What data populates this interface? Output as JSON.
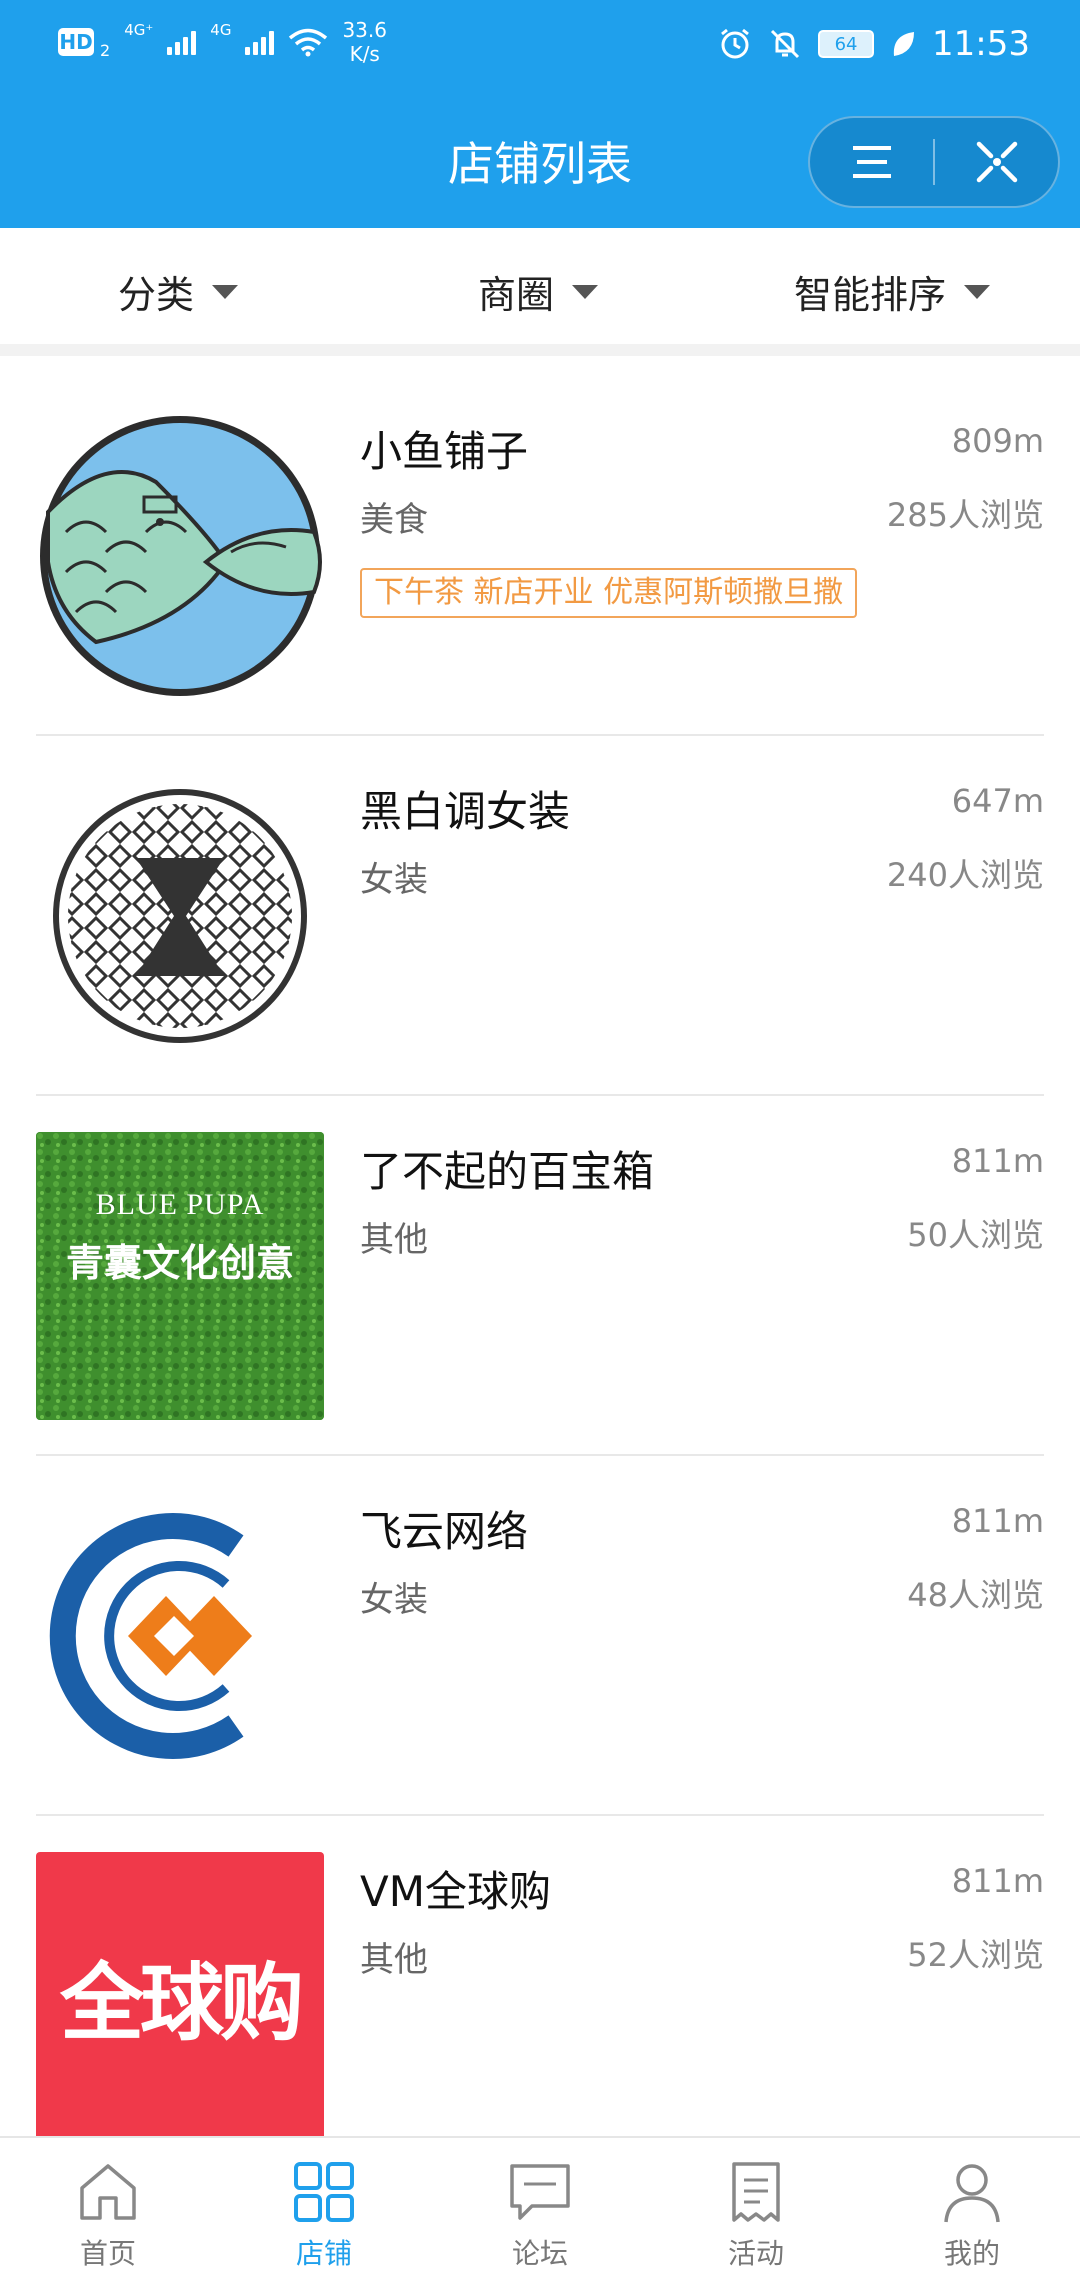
{
  "status_bar": {
    "hd": "HD",
    "hd_sub": "2",
    "net1": "4G⁺",
    "net2": "4G",
    "speed_value": "33.6",
    "speed_unit": "K/s",
    "battery": "64",
    "time": "11:53"
  },
  "header": {
    "title": "店铺列表"
  },
  "filters": [
    {
      "label": "分类"
    },
    {
      "label": "商圈"
    },
    {
      "label": "智能排序"
    }
  ],
  "shops": [
    {
      "name": "小鱼铺子",
      "category": "美食",
      "distance": "809m",
      "views": "285人浏览",
      "tag": "下午茶 新店开业 优惠阿斯顿撒旦撒"
    },
    {
      "name": "黑白调女装",
      "category": "女装",
      "distance": "647m",
      "views": "240人浏览"
    },
    {
      "name": "了不起的百宝箱",
      "category": "其他",
      "distance": "811m",
      "views": "50人浏览",
      "logo_text_en": "BLUE PUPA",
      "logo_text_cn": "青囊文化创意"
    },
    {
      "name": "飞云网络",
      "category": "女装",
      "distance": "811m",
      "views": "48人浏览"
    },
    {
      "name": "VM全球购",
      "category": "其他",
      "distance": "811m",
      "views": "52人浏览",
      "logo_text": "全球购"
    }
  ],
  "tabs": [
    {
      "label": "首页",
      "icon": "home-icon"
    },
    {
      "label": "店铺",
      "icon": "grid-icon",
      "active": true
    },
    {
      "label": "论坛",
      "icon": "chat-icon"
    },
    {
      "label": "活动",
      "icon": "receipt-icon"
    },
    {
      "label": "我的",
      "icon": "user-icon"
    }
  ],
  "colors": {
    "brand_blue": "#1fa0ec",
    "tag_orange": "#f29a43",
    "vm_red": "#f0394a",
    "grass_green": "#3f8f2e"
  }
}
